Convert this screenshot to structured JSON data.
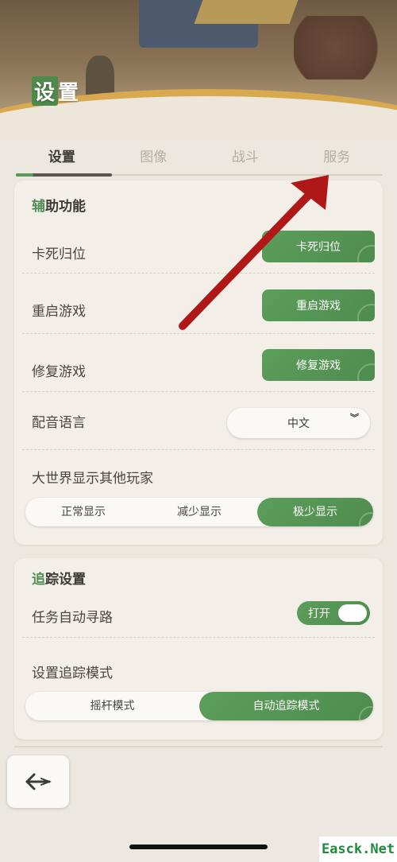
{
  "header": {
    "title_first_char": "设",
    "title_rest": "置"
  },
  "tabs": [
    {
      "label": "设置",
      "active": true
    },
    {
      "label": "图像",
      "active": false
    },
    {
      "label": "战斗",
      "active": false
    },
    {
      "label": "服务",
      "active": false
    }
  ],
  "assist": {
    "title_accent": "辅",
    "title_rest": "助功能",
    "stuck": {
      "label": "卡死归位",
      "button": "卡死归位"
    },
    "restart": {
      "label": "重启游戏",
      "button": "重启游戏"
    },
    "repair": {
      "label": "修复游戏",
      "button": "修复游戏"
    },
    "voice": {
      "label": "配音语言",
      "value": "中文"
    },
    "players": {
      "label": "大世界显示其他玩家",
      "options": [
        "正常显示",
        "减少显示",
        "极少显示"
      ],
      "selected": "极少显示"
    }
  },
  "tracking": {
    "title_accent": "追",
    "title_rest": "踪设置",
    "autopath": {
      "label": "任务自动寻路",
      "toggle_text": "打开",
      "on": true
    },
    "mode": {
      "label": "设置追踪模式",
      "options": [
        "摇杆模式",
        "自动追踪模式"
      ],
      "selected": "自动追踪模式"
    }
  },
  "icons": {
    "back": "back-arrow-icon",
    "dropdown": "double-chevron-down-icon"
  },
  "colors": {
    "accent_green": "#4f8d55",
    "annotation_red": "#b01818"
  },
  "watermark": "Easck.Net"
}
